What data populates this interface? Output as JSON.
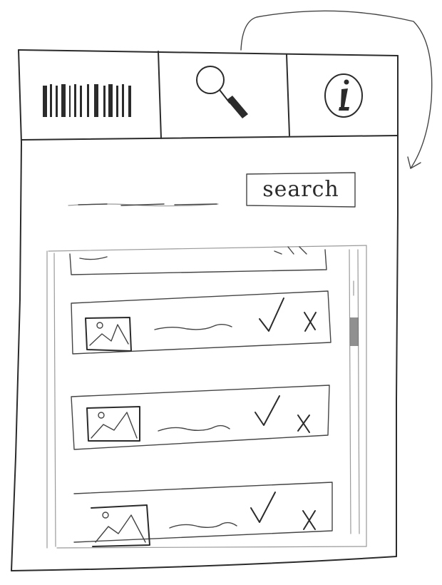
{
  "toolbar": {
    "items": [
      {
        "name": "barcode",
        "icon": "barcode-icon"
      },
      {
        "name": "search",
        "icon": "magnifier-icon"
      },
      {
        "name": "info",
        "icon": "info-icon"
      }
    ]
  },
  "search": {
    "button_label": "search"
  },
  "list": {
    "rows": [
      {
        "thumbnail": "image-icon",
        "accept": "check-icon",
        "reject": "x-icon"
      },
      {
        "thumbnail": "image-icon",
        "accept": "check-icon",
        "reject": "x-icon"
      },
      {
        "thumbnail": "image-icon",
        "accept": "check-icon",
        "reject": "x-icon"
      }
    ]
  },
  "colors": {
    "ink": "#2b2b2b",
    "paper": "#ffffff"
  }
}
